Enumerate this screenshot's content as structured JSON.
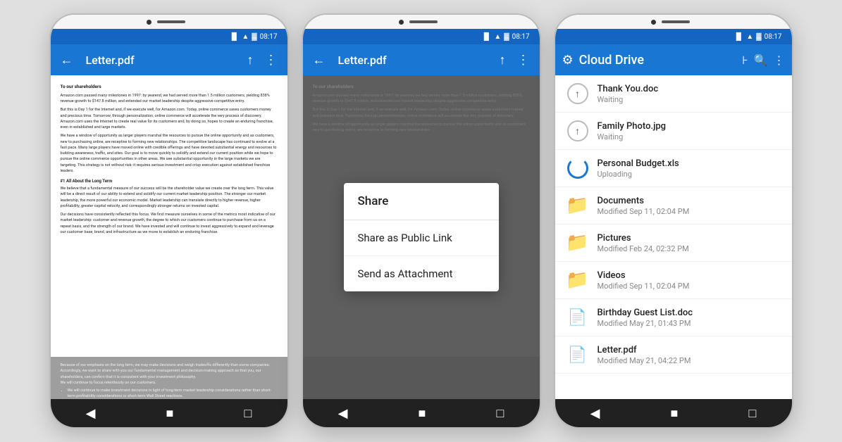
{
  "app": {
    "title": "Letter.pdf",
    "cloudTitle": "Cloud Drive",
    "time": "08:17"
  },
  "toolbar": {
    "back_label": "←",
    "share_label": "⋮",
    "more_label": "⋮"
  },
  "pdf": {
    "heading1": "To our shareholders",
    "para1": "Amazon.com passed many milestones in 1997: by yearend, we had served more than 1.5 million customers, yielding 838% revenue growth to $147.8 million, and extended our market leadership despite aggressive competitive entry.",
    "para2": "But this is Day 1 for the Internet and, if we execute well, for Amazon.com. Today, online commerce saves customers money and precious time. Tomorrow, through personalization, online commerce will accelerate the very process of discovery. Amazon.com uses the Internet to create real value for its customers and, by doing so, hopes to create an enduring franchise, even in established and large markets.",
    "para3": "We have a window of opportunity as larger players marshal the resources to pursue the online opportunity and as customers, new to purchasing online, are receptive to forming new relationships. The competitive landscape has continued to evolve at a fast pace. Many large players have moved online with credible offerings and have devoted substantial energy and resources to building awareness, traffic, and sites. Our goal is to move quickly to solidify and extend our current position while we hope to pursue the online commerce opportunities in other areas. We see substantial opportunity in the large markets we are targeting. This strategy is not without risk: it requires serious investment and crisp execution against established franchise leaders.",
    "heading2": "#1 All About the Long Term",
    "para4": "We believe that a fundamental measure of our success will be the shareholder value we create over the long term. This value will be a direct result of our ability to extend and solidify our current market leadership position. The stronger our market leadership, the more powerful our economic model. Market leadership can translate directly to higher revenue, higher profitability, greater capital velocity, and correspondingly stronger returns on invested capital.",
    "para5": "Our decisions have consistently reflected this focus. We first measure ourselves in some of the metrics most indicative of our market leadership: customer and revenue growth, the degree to which our customers continue to purchase from us on a repeat basis, and the strength of our brand. We have invested and will continue to invest aggressively to expand and leverage our customer base, brand, and infrastructure as we move to establish an enduring franchise.",
    "para_bottom1": "Because of our emphasis on the long term, we may make decisions and weigh tradeoffs differently than some companies. Accordingly, we want to share with you our fundamental management and decision-making approach so that you, our shareholders, can confirm that it is consistent with your investment philosophy.",
    "para_bottom2": "We will continue to focus relentlessly on our customers.",
    "bullet1": "We will continue to make investment decisions in light of long-term market leadership considerations rather than short-term profitability considerations or short-term Wall Street reactions."
  },
  "modal": {
    "title": "Share",
    "option1": "Share as Public Link",
    "option2": "Send as Attachment"
  },
  "files": [
    {
      "name": "Thank You.doc",
      "meta": "Waiting",
      "icon": "upload",
      "status": "waiting"
    },
    {
      "name": "Family Photo.jpg",
      "meta": "Waiting",
      "icon": "upload",
      "status": "waiting"
    },
    {
      "name": "Personal Budget.xls",
      "meta": "Uploading",
      "icon": "uploading",
      "status": "uploading"
    },
    {
      "name": "Documents",
      "meta": "Modified Sep 11, 02:04 PM",
      "icon": "folder",
      "status": "folder"
    },
    {
      "name": "Pictures",
      "meta": "Modified Feb 24, 02:32 PM",
      "icon": "folder",
      "status": "folder"
    },
    {
      "name": "Videos",
      "meta": "Modified Sep 11, 02:04 PM",
      "icon": "folder",
      "status": "folder"
    },
    {
      "name": "Birthday Guest List.doc",
      "meta": "Modified May 21, 01:43 PM",
      "icon": "doc",
      "status": "doc"
    },
    {
      "name": "Letter.pdf",
      "meta": "Modified May 21, 04:22 PM",
      "icon": "pdf",
      "status": "pdf"
    }
  ]
}
